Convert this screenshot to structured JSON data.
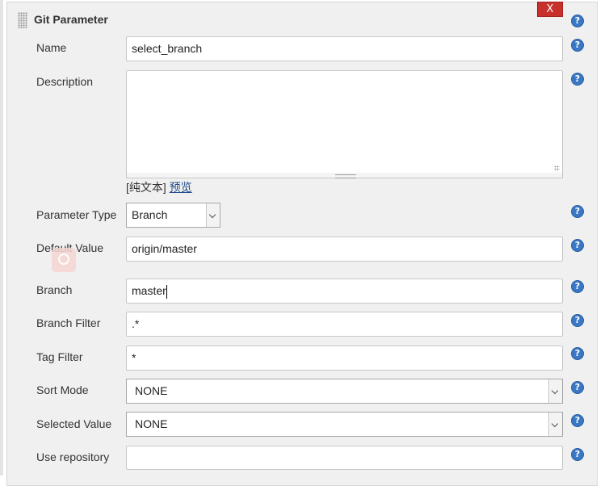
{
  "section": {
    "title": "Git Parameter",
    "close_label": "X"
  },
  "fields": {
    "name": {
      "label": "Name",
      "value": "select_branch"
    },
    "description": {
      "label": "Description",
      "value": ""
    },
    "format": {
      "plain_text": "[纯文本]",
      "preview_link": "预览"
    },
    "parameter_type": {
      "label": "Parameter Type",
      "selected": "Branch"
    },
    "default_value": {
      "label": "Default Value",
      "value": "origin/master"
    },
    "branch": {
      "label": "Branch",
      "value": "master"
    },
    "branch_filter": {
      "label": "Branch Filter",
      "value": ".*"
    },
    "tag_filter": {
      "label": "Tag Filter",
      "value": "*"
    },
    "sort_mode": {
      "label": "Sort Mode",
      "selected": "NONE"
    },
    "selected_value": {
      "label": "Selected Value",
      "selected": "NONE"
    },
    "use_repository": {
      "label": "Use repository",
      "value": ""
    }
  },
  "icons": {
    "help": "help-icon",
    "grip": "drag-handle-icon",
    "overlay": "search-icon"
  },
  "colors": {
    "close_button": "#c8312b",
    "help_icon": "#3a78c4",
    "link": "#204a87",
    "panel_bg": "#f0f0f0"
  }
}
